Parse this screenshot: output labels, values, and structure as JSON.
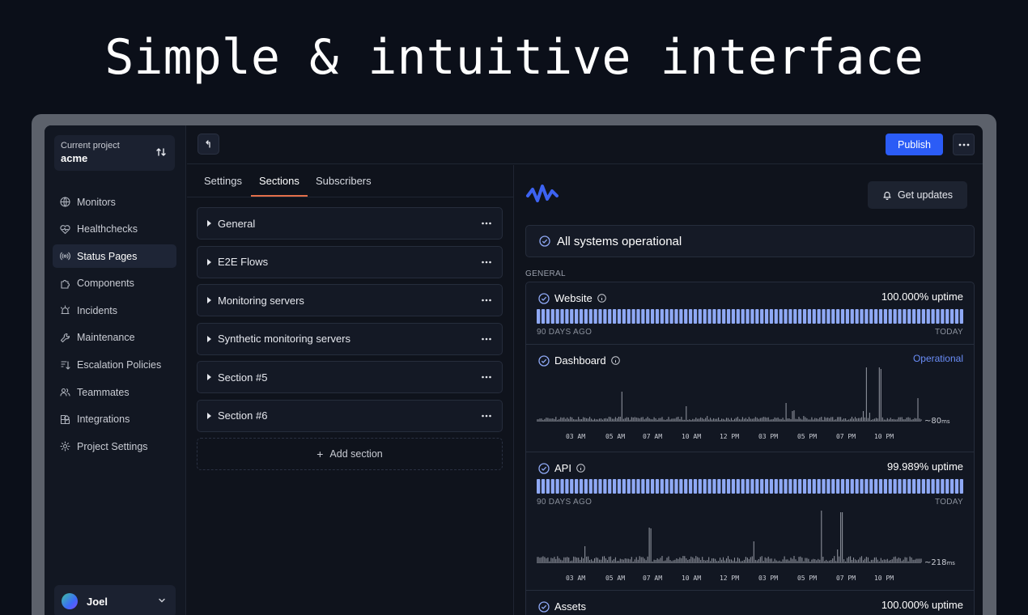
{
  "headline": "Simple & intuitive interface",
  "sidebar": {
    "project_label": "Current project",
    "project_value": "acme",
    "items": [
      {
        "label": "Monitors",
        "icon": "globe-icon"
      },
      {
        "label": "Healthchecks",
        "icon": "heartbeat-icon"
      },
      {
        "label": "Status Pages",
        "icon": "broadcast-icon",
        "active": true
      },
      {
        "label": "Components",
        "icon": "puzzle-icon"
      },
      {
        "label": "Incidents",
        "icon": "siren-icon"
      },
      {
        "label": "Maintenance",
        "icon": "wrench-icon"
      },
      {
        "label": "Escalation Policies",
        "icon": "escalation-icon"
      },
      {
        "label": "Teammates",
        "icon": "users-icon"
      },
      {
        "label": "Integrations",
        "icon": "blocks-icon"
      },
      {
        "label": "Project Settings",
        "icon": "gear-icon"
      }
    ],
    "user": "Joel"
  },
  "topbar": {
    "publish_label": "Publish"
  },
  "editor": {
    "tabs": [
      {
        "label": "Settings"
      },
      {
        "label": "Sections",
        "active": true
      },
      {
        "label": "Subscribers"
      }
    ],
    "sections": [
      "General",
      "E2E Flows",
      "Monitoring servers",
      "Synthetic monitoring servers",
      "Section #5",
      "Section #6"
    ],
    "add_section_label": "Add section"
  },
  "preview": {
    "get_updates_label": "Get updates",
    "overall_status": "All systems operational",
    "group_label": "GENERAL",
    "colors": {
      "accent": "#2b5cf6",
      "bar": "#8fa9f5",
      "operational": "#6a8df8"
    },
    "components": [
      {
        "name": "Website",
        "uptime": "100.000% uptime",
        "range_start": "90 DAYS AGO",
        "range_end": "TODAY",
        "kind": "bars"
      },
      {
        "name": "Dashboard",
        "status": "Operational",
        "kind": "response",
        "latency": "~80",
        "latency_unit": "ms",
        "ticks": [
          "03 AM",
          "05 AM",
          "07 AM",
          "10 AM",
          "12 PM",
          "03 PM",
          "05 PM",
          "07 PM",
          "10 PM"
        ]
      },
      {
        "name": "API",
        "uptime": "99.989% uptime",
        "range_start": "90 DAYS AGO",
        "range_end": "TODAY",
        "kind": "bars+response",
        "latency": "~218",
        "latency_unit": "ms",
        "ticks": [
          "03 AM",
          "05 AM",
          "07 AM",
          "10 AM",
          "12 PM",
          "03 PM",
          "05 PM",
          "07 PM",
          "10 PM"
        ]
      },
      {
        "name": "Assets",
        "uptime": "100.000% uptime",
        "kind": "bars"
      }
    ]
  }
}
